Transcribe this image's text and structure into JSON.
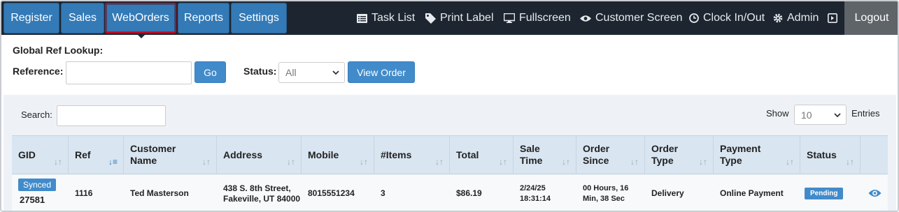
{
  "nav": {
    "register": "Register",
    "sales": "Sales",
    "weborders": "WebOrders",
    "reports": "Reports",
    "settings": "Settings",
    "task_list": "Task List",
    "print_label": "Print Label",
    "fullscreen": "Fullscreen",
    "customer_screen": "Customer Screen",
    "clock": "Clock In/Out",
    "admin": "Admin",
    "logout": "Logout",
    "active_tab": "WebOrders"
  },
  "lookup": {
    "title": "Global Ref Lookup:",
    "reference_label": "Reference:",
    "reference_value": "",
    "go": "Go",
    "status_label": "Status:",
    "status_selected": "All",
    "view_order": "View Order"
  },
  "table_controls": {
    "search_label": "Search:",
    "search_value": "",
    "show_label": "Show",
    "entries_selected": "10",
    "entries_label": "Entries"
  },
  "table": {
    "columns": [
      "GID",
      "Ref",
      "Customer Name",
      "Address",
      "Mobile",
      "#Items",
      "Total",
      "Sale Time",
      "Order Since",
      "Order Type",
      "Payment Type",
      "Status"
    ],
    "sorted_column": "Ref",
    "row": {
      "gid_badge": "Synced",
      "gid": "27581",
      "ref": "1116",
      "customer": "Ted Masterson",
      "address": "438 S. 8th Street, Fakeville, UT 84000",
      "mobile": "8015551234",
      "items": "3",
      "total": "$86.19",
      "sale_time": "2/24/25 18:31:14",
      "order_since": "00 Hours, 16 Min, 38 Sec",
      "order_type": "Delivery",
      "payment_type": "Online Payment",
      "status": "Pending"
    }
  },
  "colors": {
    "nav_bg": "#1d2630",
    "button_blue": "#337ab7",
    "active_border": "#d0021b",
    "logout_bg": "#5f6468",
    "header_bg": "#d9e5f0"
  },
  "icons": [
    "list-icon",
    "tag-icon",
    "monitor-icon",
    "eye-icon",
    "clock-icon",
    "gear-icon",
    "exit-icon",
    "sort-icon",
    "eye-icon"
  ]
}
